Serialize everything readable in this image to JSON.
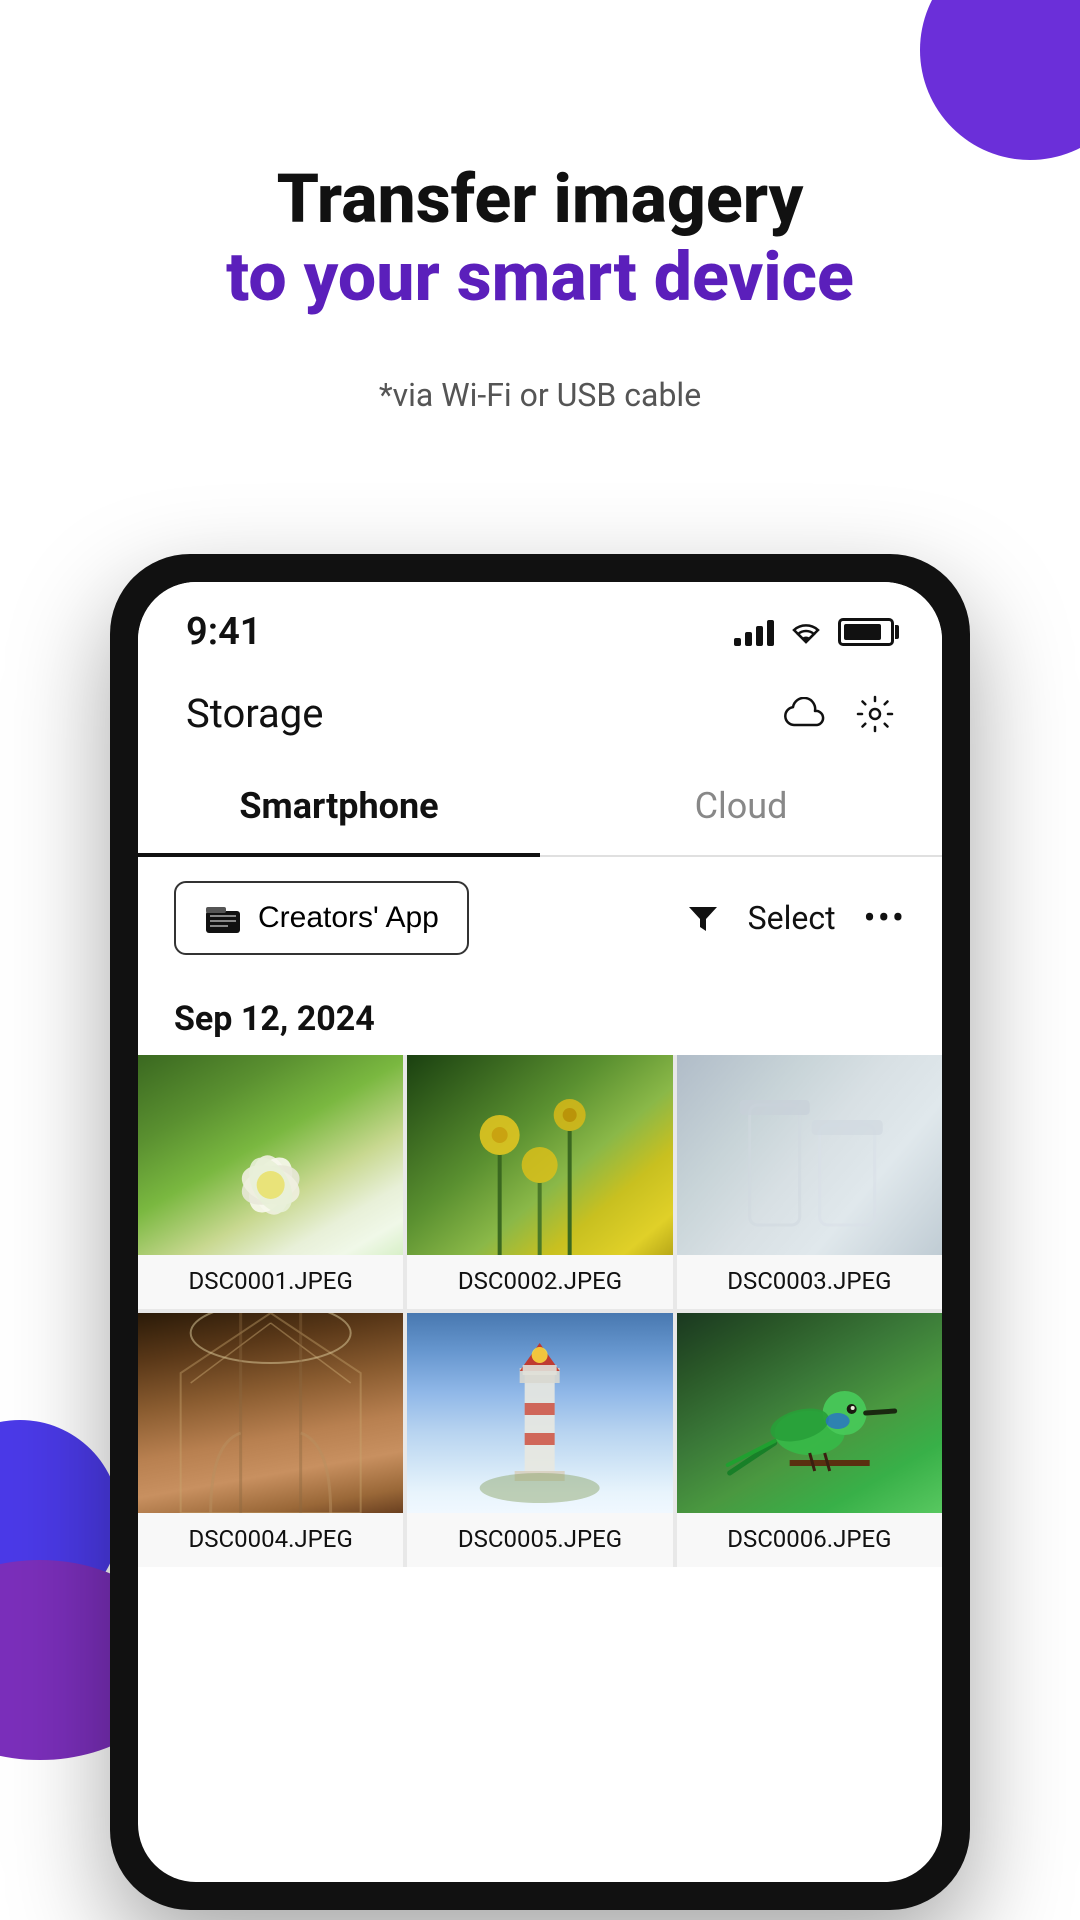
{
  "page": {
    "background_color": "#ffffff"
  },
  "hero": {
    "title_line1": "Transfer imagery",
    "title_line2": "to your smart device",
    "subtitle": "*via Wi-Fi or USB cable"
  },
  "phone": {
    "status_bar": {
      "time": "9:41"
    },
    "header": {
      "title": "Storage",
      "cloud_icon_label": "cloud-icon",
      "settings_icon_label": "settings-icon"
    },
    "tabs": [
      {
        "label": "Smartphone",
        "active": true
      },
      {
        "label": "Cloud",
        "active": false
      }
    ],
    "toolbar": {
      "app_selector_label": "Creators' App",
      "filter_label": "filter-icon",
      "select_label": "Select",
      "more_label": "..."
    },
    "date_heading": "Sep 12, 2024",
    "photos": [
      {
        "filename": "DSC0001.JPEG",
        "thumb_class": "thumb-1"
      },
      {
        "filename": "DSC0002.JPEG",
        "thumb_class": "thumb-2"
      },
      {
        "filename": "DSC0003.JPEG",
        "thumb_class": "thumb-3"
      },
      {
        "filename": "DSC0004.JPEG",
        "thumb_class": "thumb-4"
      },
      {
        "filename": "DSC0005.JPEG",
        "thumb_class": "thumb-5"
      },
      {
        "filename": "DSC0006.JPEG",
        "thumb_class": "thumb-6"
      }
    ]
  },
  "colors": {
    "accent_purple": "#5B1FBB",
    "deco_purple1": "#6B2FD9",
    "deco_purple2": "#4B3AE8",
    "text_dark": "#111111",
    "tab_underline": "#111111"
  }
}
